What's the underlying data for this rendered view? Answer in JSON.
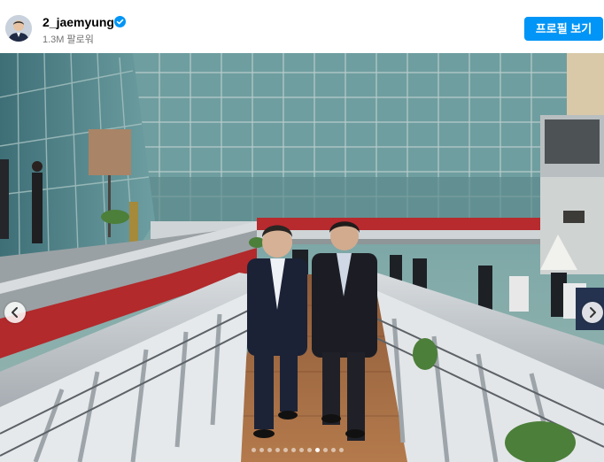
{
  "post": {
    "username": "2_jaemyung",
    "followers": "1.3M 팔로워",
    "profile_button": "프로필 보기"
  },
  "icons": {
    "verified": "verified-badge-icon",
    "prev": "chevron-left-icon",
    "next": "chevron-right-icon"
  },
  "carousel": {
    "total_slides": 12,
    "active_index": 8
  },
  "colors": {
    "accent": "#0095f6",
    "verified": "#0095f6",
    "followers_text": "#737373"
  }
}
